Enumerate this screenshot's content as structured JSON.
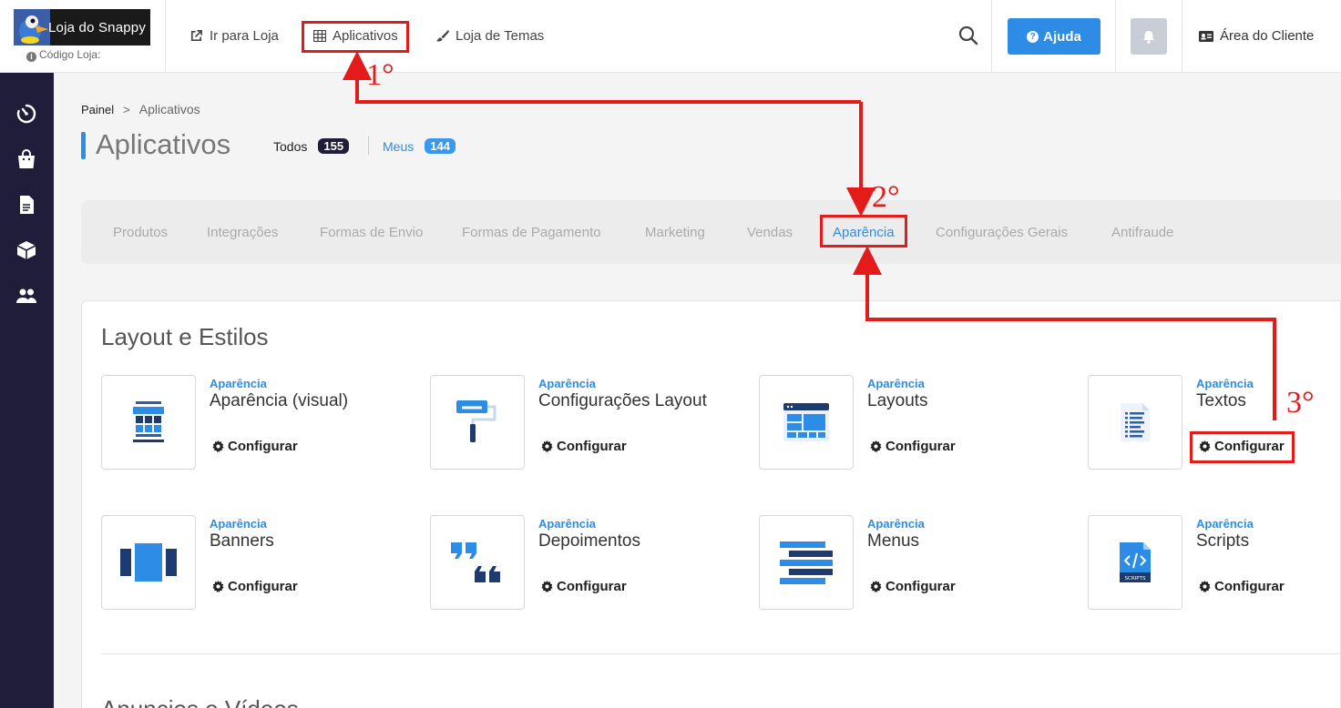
{
  "header": {
    "logo_text": "Loja do Snappy",
    "store_code_label": "Código Loja:",
    "nav": [
      {
        "label": "Ir para Loja",
        "icon": "external-link-icon"
      },
      {
        "label": "Aplicativos",
        "icon": "grid-icon"
      },
      {
        "label": "Loja de Temas",
        "icon": "brush-icon"
      }
    ],
    "help_label": "Ajuda",
    "client_label": "Área do Cliente"
  },
  "sidebar": {
    "icons": [
      "dashboard-icon",
      "shopping-bag-icon",
      "document-icon",
      "box-icon",
      "users-icon"
    ]
  },
  "breadcrumb": {
    "root": "Painel",
    "separator": ">",
    "current": "Aplicativos"
  },
  "page": {
    "title": "Aplicativos",
    "all_label": "Todos",
    "all_count": "155",
    "mine_label": "Meus",
    "mine_count": "144"
  },
  "tabs": [
    "Produtos",
    "Integrações",
    "Formas de Envio",
    "Formas de Pagamento",
    "Marketing",
    "Vendas",
    "Aparência",
    "Configurações Gerais",
    "Antifraude"
  ],
  "active_tab": "Aparência",
  "section": {
    "title": "Layout e Estilos",
    "next_title": "Anuncios e Vídeos"
  },
  "apps": [
    {
      "category": "Aparência",
      "name": "Aparência (visual)",
      "action": "Configurar",
      "icon": "visual-layout-icon"
    },
    {
      "category": "Aparência",
      "name": "Configurações Layout",
      "action": "Configurar",
      "icon": "paint-roller-icon"
    },
    {
      "category": "Aparência",
      "name": "Layouts",
      "action": "Configurar",
      "icon": "browser-layout-icon"
    },
    {
      "category": "Aparência",
      "name": "Textos",
      "action": "Configurar",
      "icon": "text-document-icon"
    },
    {
      "category": "Aparência",
      "name": "Banners",
      "action": "Configurar",
      "icon": "banner-slides-icon"
    },
    {
      "category": "Aparência",
      "name": "Depoimentos",
      "action": "Configurar",
      "icon": "quote-icon"
    },
    {
      "category": "Aparência",
      "name": "Menus",
      "action": "Configurar",
      "icon": "menu-lines-icon"
    },
    {
      "category": "Aparência",
      "name": "Scripts",
      "action": "Configurar",
      "icon": "code-file-icon"
    }
  ],
  "annotations": {
    "step1": "1°",
    "step2": "2°",
    "step3": "3°",
    "color": "#e31b1b"
  },
  "colors": {
    "accent": "#2d8de6",
    "sidebar": "#201d3a",
    "highlight": "#e31b1b"
  }
}
